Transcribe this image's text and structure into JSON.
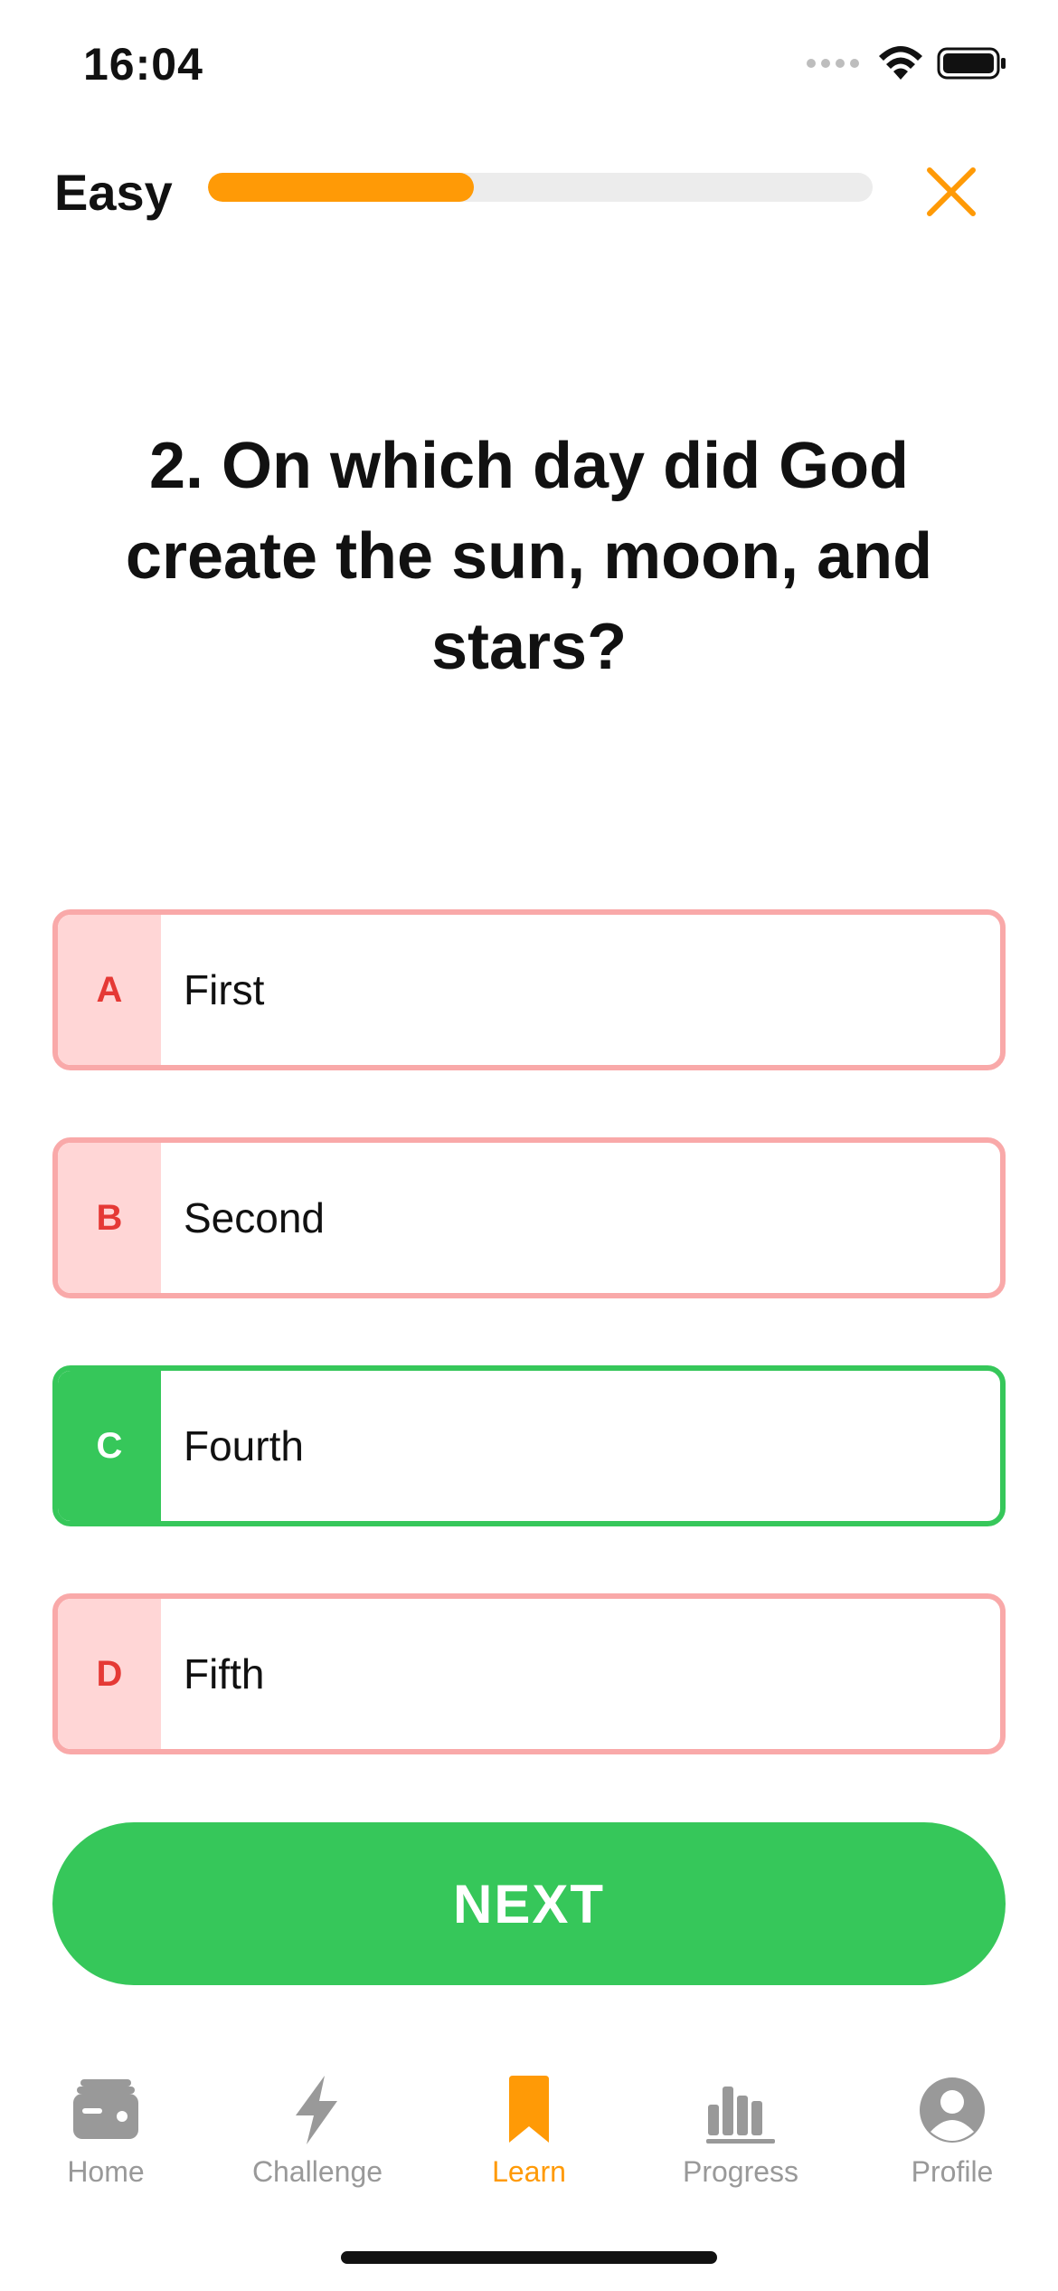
{
  "status_bar": {
    "time": "16:04"
  },
  "quiz": {
    "difficulty": "Easy",
    "progress": 0.4,
    "question": "2. On which day did God create the sun, moon, and stars?",
    "answers": [
      {
        "letter": "A",
        "text": "First",
        "state": "wrong"
      },
      {
        "letter": "B",
        "text": "Second",
        "state": "wrong"
      },
      {
        "letter": "C",
        "text": "Fourth",
        "state": "correct"
      },
      {
        "letter": "D",
        "text": "Fifth",
        "state": "wrong"
      }
    ],
    "next_label": "NEXT"
  },
  "colors": {
    "accent": "#ff9a06",
    "correct": "#36c75a",
    "wrong_border": "#f9a9a9",
    "wrong_fill": "#ffd6d6",
    "wrong_letter": "#e53935",
    "inactive_tab": "#999999"
  },
  "tabs": [
    {
      "label": "Home",
      "icon": "wallet-icon",
      "active": false
    },
    {
      "label": "Challenge",
      "icon": "lightning-icon",
      "active": false
    },
    {
      "label": "Learn",
      "icon": "bookmark-icon",
      "active": true
    },
    {
      "label": "Progress",
      "icon": "bar-chart-icon",
      "active": false
    },
    {
      "label": "Profile",
      "icon": "person-icon",
      "active": false
    }
  ]
}
